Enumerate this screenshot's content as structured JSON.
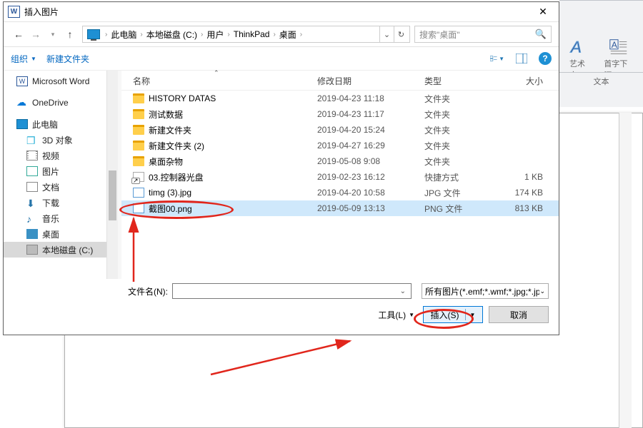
{
  "dialog": {
    "title": "插入图片",
    "close_x": "✕",
    "breadcrumb": [
      "此电脑",
      "本地磁盘 (C:)",
      "用户",
      "ThinkPad",
      "桌面"
    ],
    "search_placeholder": "搜索\"桌面\"",
    "organize_label": "组织",
    "newfolder_label": "新建文件夹",
    "columns": {
      "name": "名称",
      "date": "修改日期",
      "type": "类型",
      "size": "大小"
    },
    "filename_label": "文件名(N):",
    "filename_value": "",
    "filetype_label": "所有图片(*.emf;*.wmf;*.jpg;*.jpeg;*.jfif;*.jpe;*.png;*.bmp;*.dib;*.rle;*.gif;*.emz;*.wmz;*.pcz;*.tif;*.tiff;*.cgm;*.eps;*.pct;*.pict;*.wpg)",
    "tools_label": "工具(L)",
    "insert_label": "插入(S)",
    "cancel_label": "取消"
  },
  "tree": [
    {
      "icon": "word",
      "label": "Microsoft Word",
      "lvl": 1
    },
    {
      "icon": "cloud",
      "label": "OneDrive",
      "lvl": 1
    },
    {
      "icon": "pc",
      "label": "此电脑",
      "lvl": 1
    },
    {
      "icon": "3d",
      "label": "3D 对象",
      "lvl": 2
    },
    {
      "icon": "vid",
      "label": "视频",
      "lvl": 2
    },
    {
      "icon": "pic",
      "label": "图片",
      "lvl": 2
    },
    {
      "icon": "doc",
      "label": "文档",
      "lvl": 2
    },
    {
      "icon": "dl",
      "label": "下载",
      "lvl": 2
    },
    {
      "icon": "mus",
      "label": "音乐",
      "lvl": 2
    },
    {
      "icon": "desk",
      "label": "桌面",
      "lvl": 2
    },
    {
      "icon": "disk",
      "label": "本地磁盘 (C:)",
      "lvl": 2,
      "sel": true
    }
  ],
  "files": [
    {
      "icon": "fld",
      "name": "HISTORY DATAS",
      "date": "2019-04-23 11:18",
      "type": "文件夹",
      "size": ""
    },
    {
      "icon": "fld",
      "name": "测试数据",
      "date": "2019-04-23 11:17",
      "type": "文件夹",
      "size": ""
    },
    {
      "icon": "fld",
      "name": "新建文件夹",
      "date": "2019-04-20 15:24",
      "type": "文件夹",
      "size": ""
    },
    {
      "icon": "fld",
      "name": "新建文件夹 (2)",
      "date": "2019-04-27 16:29",
      "type": "文件夹",
      "size": ""
    },
    {
      "icon": "fld",
      "name": "桌面杂物",
      "date": "2019-05-08 9:08",
      "type": "文件夹",
      "size": ""
    },
    {
      "icon": "short",
      "name": "03.控制器光盘",
      "date": "2019-02-23 16:12",
      "type": "快捷方式",
      "size": "1 KB"
    },
    {
      "icon": "jpg",
      "name": "timg (3).jpg",
      "date": "2019-04-20 10:58",
      "type": "JPG 文件",
      "size": "174 KB"
    },
    {
      "icon": "png",
      "name": "截图00.png",
      "date": "2019-05-09 13:13",
      "type": "PNG 文件",
      "size": "813 KB",
      "sel": true
    }
  ],
  "ribbon": {
    "wordart_label": "艺术字",
    "dropcap_label": "首字下沉",
    "group_label": "文本"
  }
}
